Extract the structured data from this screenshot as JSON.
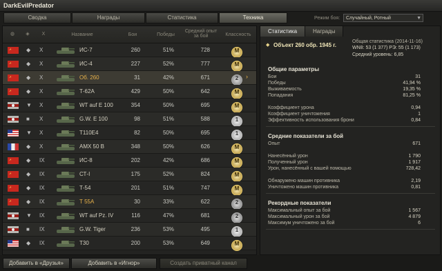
{
  "window": {
    "title": "DarkEvilPredator"
  },
  "tabs": [
    "Сводка",
    "Награды",
    "Статистика",
    "Техника"
  ],
  "active_tab": 3,
  "battle_mode": {
    "label": "Режим боя:",
    "value": "Случайный, Ротный"
  },
  "table": {
    "headers": {
      "name": "Название",
      "battles": "Бои",
      "wins": "Победы",
      "avg_exp": "Средний опыт за бой",
      "mastery": "Классность"
    },
    "rows": [
      {
        "nation": "ussr",
        "cls": "heavy",
        "tier": "X",
        "name": "ИС-7",
        "battles": "260",
        "wins": "51%",
        "exp": "728",
        "badge": "M",
        "selected": false,
        "premium": false
      },
      {
        "nation": "ussr",
        "cls": "heavy",
        "tier": "X",
        "name": "ИС-4",
        "battles": "227",
        "wins": "52%",
        "exp": "777",
        "badge": "M",
        "selected": false,
        "premium": false
      },
      {
        "nation": "ussr",
        "cls": "heavy",
        "tier": "X",
        "name": "Об. 260",
        "battles": "31",
        "wins": "42%",
        "exp": "671",
        "badge": "2",
        "selected": true,
        "premium": true
      },
      {
        "nation": "ussr",
        "cls": "medium",
        "tier": "X",
        "name": "Т-62А",
        "battles": "429",
        "wins": "50%",
        "exp": "642",
        "badge": "M",
        "selected": false,
        "premium": false
      },
      {
        "nation": "germany",
        "cls": "td",
        "tier": "X",
        "name": "WT auf E 100",
        "battles": "354",
        "wins": "50%",
        "exp": "695",
        "badge": "M",
        "selected": false,
        "premium": false
      },
      {
        "nation": "germany",
        "cls": "spg",
        "tier": "X",
        "name": "G.W. E 100",
        "battles": "98",
        "wins": "51%",
        "exp": "588",
        "badge": "1",
        "selected": false,
        "premium": false
      },
      {
        "nation": "usa",
        "cls": "td",
        "tier": "X",
        "name": "T110E4",
        "battles": "82",
        "wins": "50%",
        "exp": "695",
        "badge": "1",
        "selected": false,
        "premium": false
      },
      {
        "nation": "france",
        "cls": "heavy",
        "tier": "X",
        "name": "AMX 50 B",
        "battles": "348",
        "wins": "50%",
        "exp": "626",
        "badge": "M",
        "selected": false,
        "premium": false
      },
      {
        "nation": "ussr",
        "cls": "heavy",
        "tier": "IX",
        "name": "ИС-8",
        "battles": "202",
        "wins": "42%",
        "exp": "686",
        "badge": "M",
        "selected": false,
        "premium": false
      },
      {
        "nation": "ussr",
        "cls": "light",
        "tier": "IX",
        "name": "СТ-I",
        "battles": "175",
        "wins": "52%",
        "exp": "824",
        "badge": "M",
        "selected": false,
        "premium": false
      },
      {
        "nation": "ussr",
        "cls": "medium",
        "tier": "IX",
        "name": "Т-54",
        "battles": "201",
        "wins": "51%",
        "exp": "747",
        "badge": "M",
        "selected": false,
        "premium": false
      },
      {
        "nation": "ussr",
        "cls": "medium",
        "tier": "IX",
        "name": "Т 55А",
        "battles": "30",
        "wins": "33%",
        "exp": "622",
        "badge": "2",
        "selected": false,
        "premium": true
      },
      {
        "nation": "germany",
        "cls": "td",
        "tier": "IX",
        "name": "WT auf Pz. IV",
        "battles": "116",
        "wins": "47%",
        "exp": "681",
        "badge": "2",
        "selected": false,
        "premium": false
      },
      {
        "nation": "germany",
        "cls": "spg",
        "tier": "IX",
        "name": "G.W. Tiger",
        "battles": "236",
        "wins": "53%",
        "exp": "495",
        "badge": "1",
        "selected": false,
        "premium": false
      },
      {
        "nation": "usa",
        "cls": "heavy",
        "tier": "IX",
        "name": "T30",
        "battles": "200",
        "wins": "53%",
        "exp": "649",
        "badge": "M",
        "selected": false,
        "premium": false
      }
    ]
  },
  "details": {
    "tabs": [
      "Статистика",
      "Награды"
    ],
    "vehicle_name": "Объект 260 обр. 1945 г.",
    "overall_label": "Общая статистика (2014-11-16)",
    "wn8_line": "WN8: 53 (1 377) РЭ: 55 (1 173)",
    "avg_level": "Средний уровень: 6,85",
    "sections": [
      {
        "title": "Общие параметры",
        "items": [
          {
            "label": "Бои",
            "value": "31"
          },
          {
            "label": "Победы",
            "value": "41,94 %"
          },
          {
            "label": "Выживаемость",
            "value": "19,35 %"
          },
          {
            "label": "Попадания",
            "value": "81,25 %"
          },
          {
            "label": "",
            "value": ""
          },
          {
            "label": "Коэффициент урона",
            "value": "0,94"
          },
          {
            "label": "Коэффициент уничтожения",
            "value": "1"
          },
          {
            "label": "Эффективность использования брони",
            "value": "0,84"
          }
        ]
      },
      {
        "title": "Средние показатели за бой",
        "items": [
          {
            "label": "Опыт",
            "value": "671"
          },
          {
            "label": "",
            "value": ""
          },
          {
            "label": "Нанесённый урон",
            "value": "1 790"
          },
          {
            "label": "Полученный урон",
            "value": "1 917"
          },
          {
            "label": "Урон, нанесённый с вашей помощью",
            "value": "728,42"
          },
          {
            "label": "",
            "value": ""
          },
          {
            "label": "Обнаружено машин противника",
            "value": "2,19"
          },
          {
            "label": "Уничтожено машин противника",
            "value": "0,81"
          }
        ]
      },
      {
        "title": "Рекордные показатели",
        "items": [
          {
            "label": "Максимальный опыт за бой",
            "value": "1 567"
          },
          {
            "label": "Максимальный урон за бой",
            "value": "4 879"
          },
          {
            "label": "Максимум уничтожено за бой",
            "value": "6"
          }
        ]
      }
    ]
  },
  "bottom_buttons": [
    "Добавить в «Друзья»",
    "Добавить в «Игнор»",
    "Создать приватный канал"
  ]
}
